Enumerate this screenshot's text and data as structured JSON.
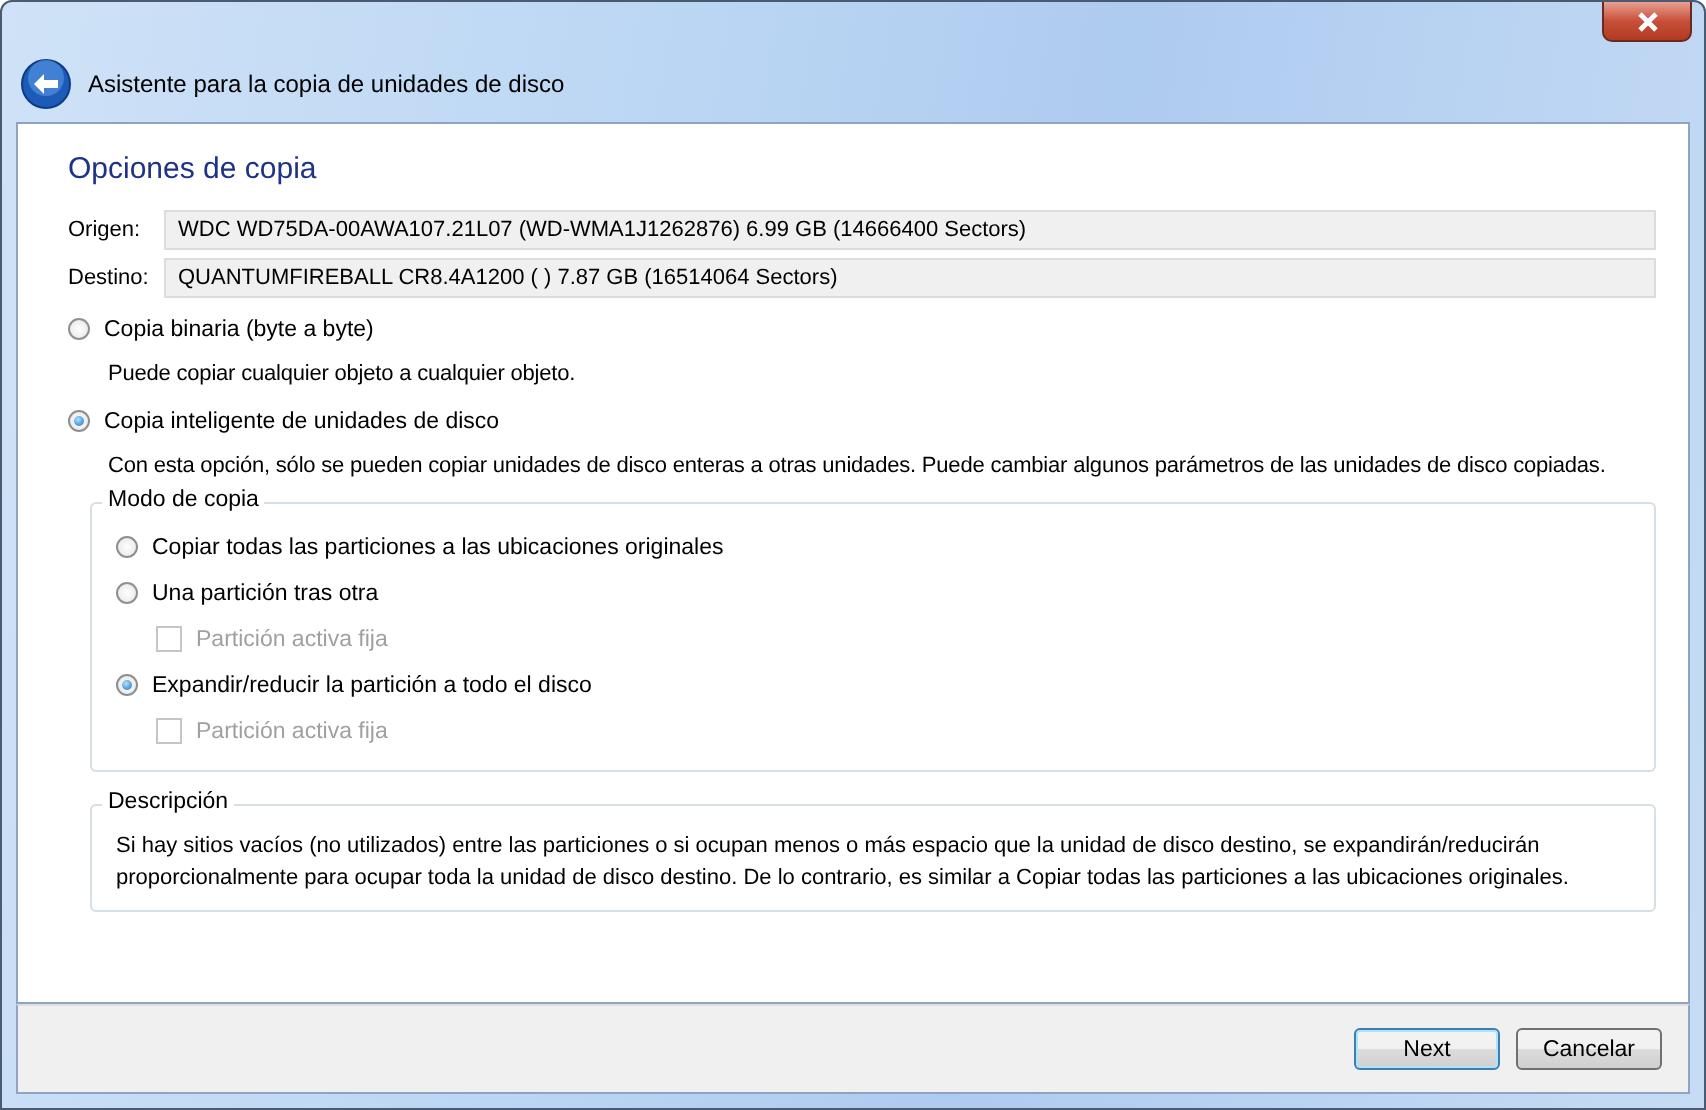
{
  "window": {
    "title": "Asistente para la copia de unidades de disco"
  },
  "heading": "Opciones de copia",
  "fields": [
    {
      "label": "Origen:",
      "value": "WDC WD75DA-00AWA107.21L07 (WD-WMA1J1262876) 6.99 GB (14666400 Sectors)"
    },
    {
      "label": "Destino:",
      "value": "QUANTUMFIREBALL CR8.4A1200 ( ) 7.87 GB (16514064 Sectors)"
    }
  ],
  "copy_types": [
    {
      "label": "Copia binaria (byte a byte)",
      "selected": false,
      "description": "Puede copiar cualquier objeto a cualquier objeto."
    },
    {
      "label": "Copia inteligente de unidades de disco",
      "selected": true,
      "description": "Con esta opción, sólo se pueden copiar unidades de disco enteras a otras unidades. Puede cambiar algunos parámetros de las unidades de disco copiadas."
    }
  ],
  "copy_mode": {
    "title": "Modo de copia",
    "options": [
      {
        "kind": "radio",
        "label": "Copiar todas las particiones a las ubicaciones originales",
        "selected": false
      },
      {
        "kind": "radio",
        "label": "Una partición tras otra",
        "selected": false
      },
      {
        "kind": "checkbox",
        "label": "Partición activa fija",
        "checked": false,
        "disabled": true
      },
      {
        "kind": "radio",
        "label": "Expandir/reducir la partición a todo el disco",
        "selected": true
      },
      {
        "kind": "checkbox",
        "label": "Partición activa fija",
        "checked": false,
        "disabled": true
      }
    ]
  },
  "description": {
    "title": "Descripción",
    "text": "Si hay sitios vacíos (no utilizados) entre las particiones o si ocupan menos o más espacio que la unidad de disco destino, se expandirán/reducirán proporcionalmente para ocupar toda la unidad de disco destino. De lo contrario, es similar a Copiar todas las particiones a las ubicaciones originales."
  },
  "buttons": [
    {
      "label": "Next",
      "default": true
    },
    {
      "label": "Cancelar",
      "default": false
    }
  ]
}
